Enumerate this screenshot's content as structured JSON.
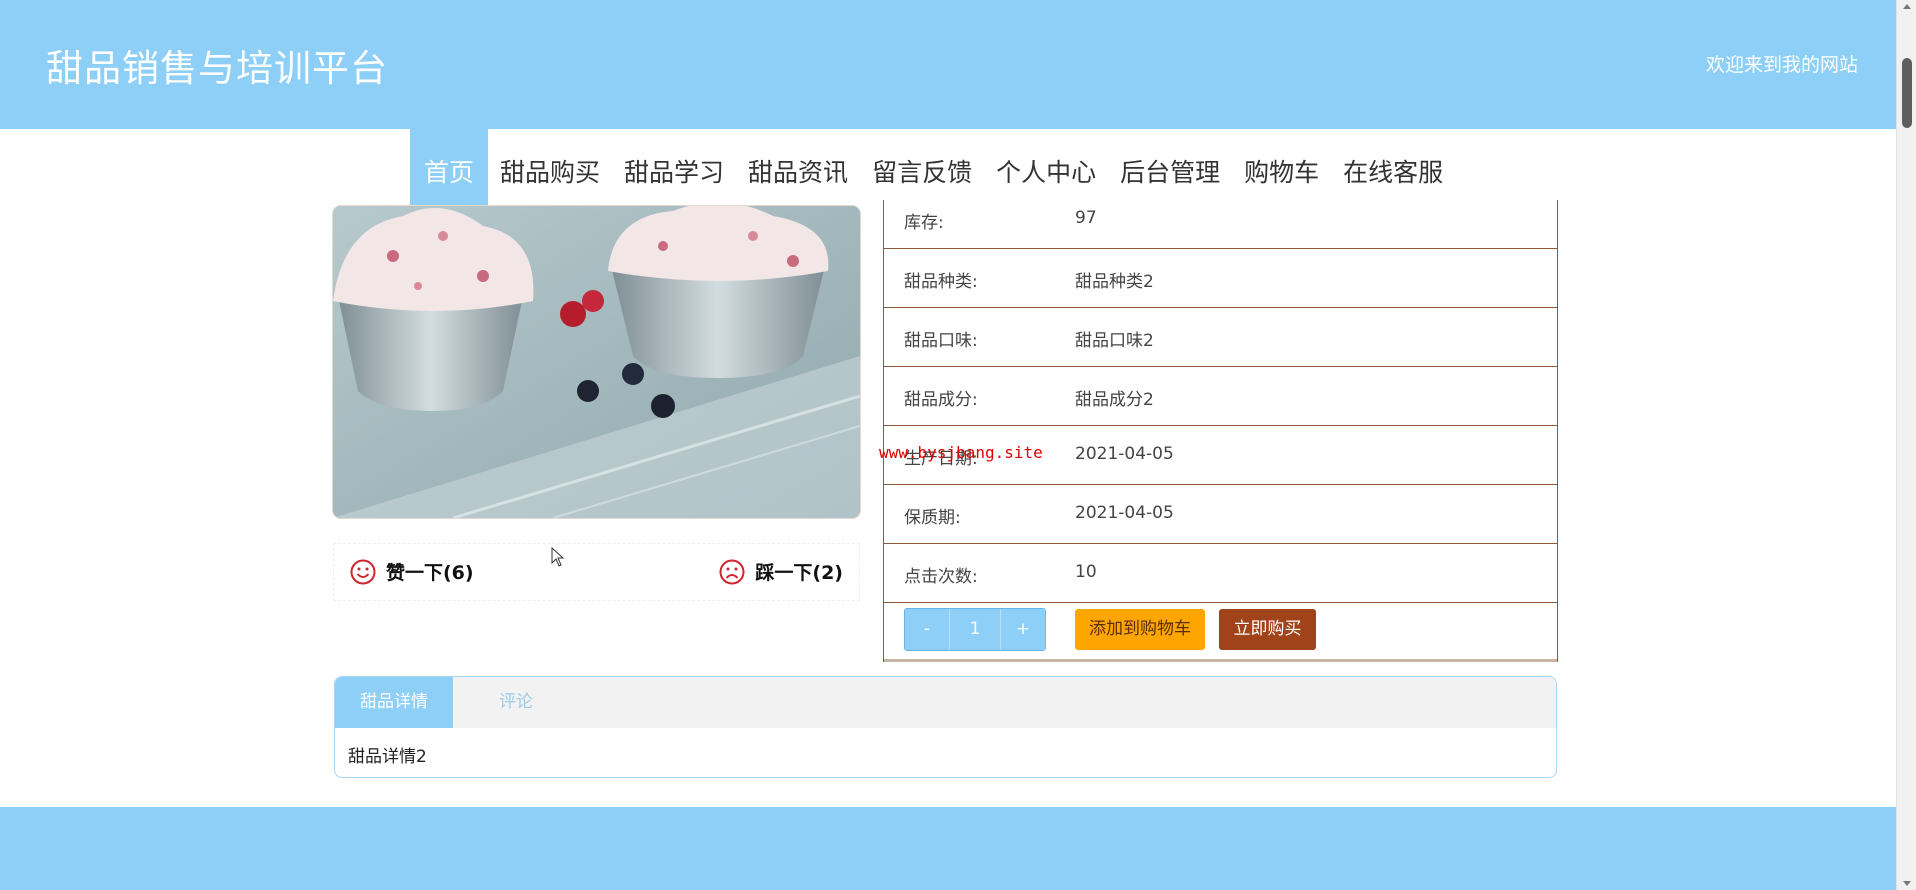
{
  "header": {
    "site_title": "甜品销售与培训平台",
    "welcome": "欢迎来到我的网站",
    "background_color": "#8ecff8"
  },
  "nav": {
    "items": [
      {
        "label": "首页",
        "active": true
      },
      {
        "label": "甜品购买"
      },
      {
        "label": "甜品学习"
      },
      {
        "label": "甜品资讯"
      },
      {
        "label": "留言反馈"
      },
      {
        "label": "个人中心"
      },
      {
        "label": "后台管理"
      },
      {
        "label": "购物车"
      },
      {
        "label": "在线客服"
      }
    ]
  },
  "product": {
    "image_icon": "ice-cream-photo",
    "votes": {
      "like": {
        "label": "赞一下(6)",
        "icon": "smile-icon"
      },
      "dislike": {
        "label": "踩一下(2)",
        "icon": "frown-icon"
      }
    },
    "info_rows": [
      {
        "label": "库存:",
        "value": "97"
      },
      {
        "label": "甜品种类:",
        "value": "甜品种类2"
      },
      {
        "label": "甜品口味:",
        "value": "甜品口味2"
      },
      {
        "label": "甜品成分:",
        "value": "甜品成分2"
      },
      {
        "label": "生产日期:",
        "value": "2021-04-05"
      },
      {
        "label": "保质期:",
        "value": "2021-04-05"
      },
      {
        "label": "点击次数:",
        "value": "10"
      }
    ],
    "quantity": {
      "minus": "-",
      "value": "1",
      "plus": "+"
    },
    "add_to_cart_label": "添加到购物车",
    "buy_now_label": "立即购买"
  },
  "watermark": "www.bysjbang.site",
  "tabs": {
    "items": [
      {
        "label": "甜品详情",
        "active": true
      },
      {
        "label": "评论"
      }
    ],
    "content": "甜品详情2"
  },
  "colors": {
    "accent": "#8ecff8",
    "cart_button": "#ffa500",
    "buy_button": "#a0421a",
    "table_border": "#8b5a3c"
  }
}
